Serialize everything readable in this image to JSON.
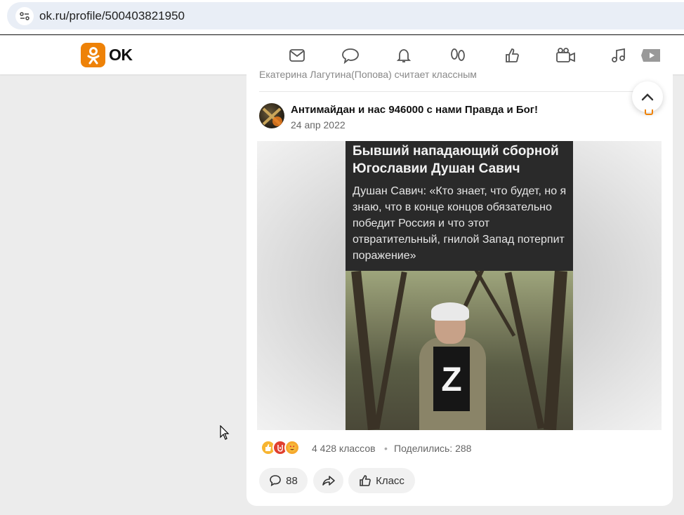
{
  "browser": {
    "url": "ok.ru/profile/500403821950"
  },
  "header": {
    "logo_text": "OK",
    "nav_icons": [
      "mail-icon",
      "chat-icon",
      "bell-icon",
      "guests-icon",
      "like-icon",
      "video-icon",
      "music-icon",
      "tv-icon"
    ]
  },
  "feed": {
    "previous_item_text": "Екатерина Лагутина(Попова) считает классным",
    "post": {
      "group_name": "Антимайдан и нас 946000 с нами Правда и Бог!",
      "date": "24 апр 2022",
      "image_title": "Бывший нападающий сборной Югославии Душан Савич",
      "image_quote": "Душан Савич: «Кто знает, что будет, но я знаю, что в конце концов обязательно победит Россия и что этот отвратительный, гнилой Запад потерпит поражение»",
      "image_shirt_letter": "Z",
      "classes_count": "4 428 классов",
      "separator": "•",
      "shared": "Поделились: 288",
      "comments_count": "88",
      "like_label": "Класс"
    }
  },
  "colors": {
    "brand": "#ee8208",
    "address_bar": "#e9eef6",
    "page_bg": "#ececec"
  }
}
